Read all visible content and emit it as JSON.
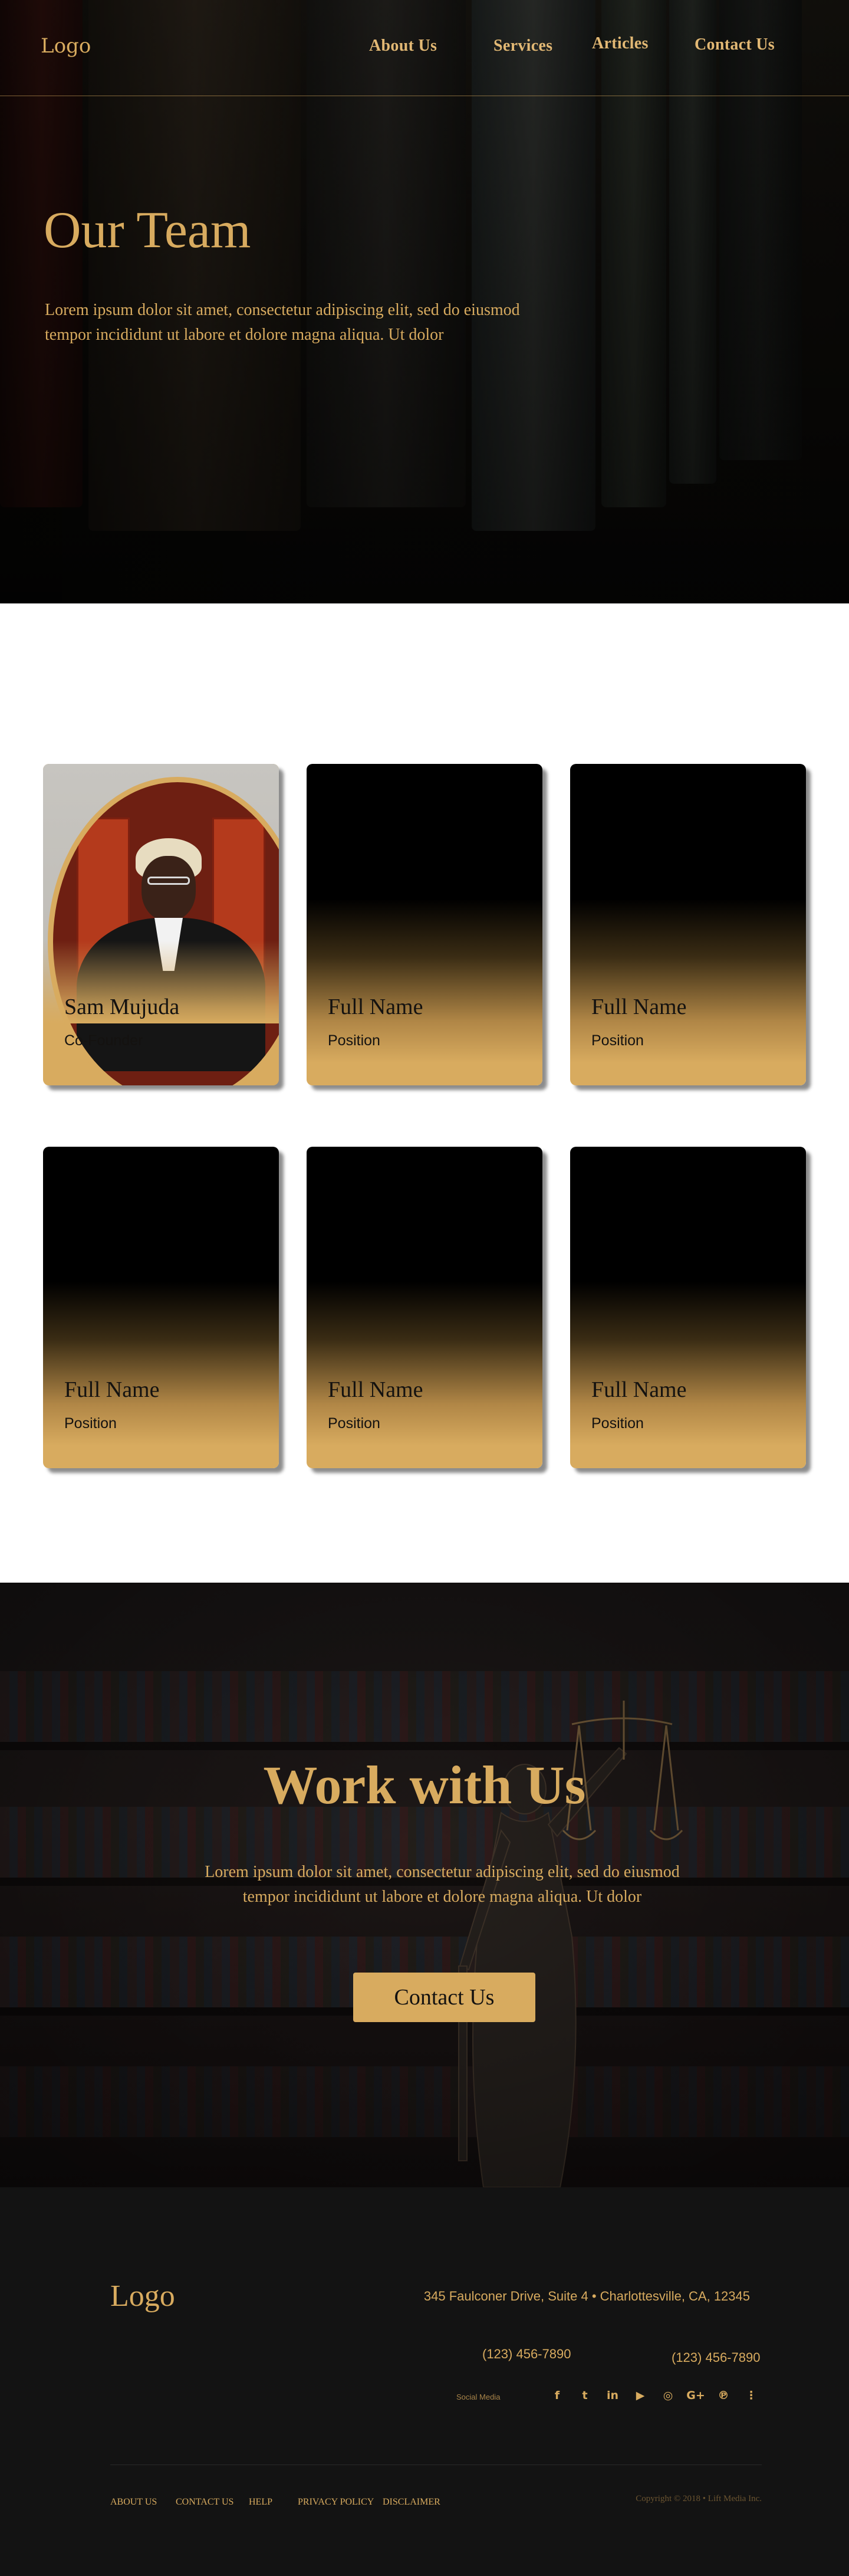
{
  "header": {
    "logo": "Logo",
    "nav": [
      "About Us",
      "Services",
      "Articles",
      "Contact Us"
    ]
  },
  "hero": {
    "title": "Our Team",
    "text": "Lorem ipsum dolor sit amet, consectetur adipiscing elit, sed do eiusmod  tempor incididunt ut labore et dolore magna aliqua. Ut dolor"
  },
  "team": {
    "members": [
      {
        "name": "Sam Mujuda",
        "position": "Co-Founder"
      },
      {
        "name": "Full Name",
        "position": "Position"
      },
      {
        "name": "Full Name",
        "position": "Position"
      },
      {
        "name": "Full Name",
        "position": "Position"
      },
      {
        "name": "Full Name",
        "position": "Position"
      },
      {
        "name": "Full Name",
        "position": "Position"
      }
    ]
  },
  "work": {
    "title": "Work with Us",
    "text": "Lorem ipsum dolor sit amet, consectetur adipiscing elit, sed do eiusmod  tempor incididunt ut labore et dolore magna aliqua. Ut dolor",
    "button": "Contact Us"
  },
  "footer": {
    "logo": "Logo",
    "address": "345 Faulconer Drive, Suite 4 • Charlottesville, CA, 12345",
    "phones": [
      "(123) 456-7890",
      "(123) 456-7890"
    ],
    "social_label": "Social Media",
    "social_icons": [
      "facebook-icon",
      "twitter-icon",
      "linkedin-icon",
      "youtube-icon",
      "instagram-icon",
      "google-plus-icon",
      "pinterest-icon",
      "rss-icon"
    ],
    "links": [
      "ABOUT US",
      "CONTACT US",
      "HELP",
      "PRIVACY POLICY",
      "DISCLAIMER"
    ],
    "copyright": "Copyright © 2018 • Lift Media Inc."
  },
  "colors": {
    "accent": "#d8ab5f",
    "dark": "#131313",
    "text_dark": "#141210"
  }
}
